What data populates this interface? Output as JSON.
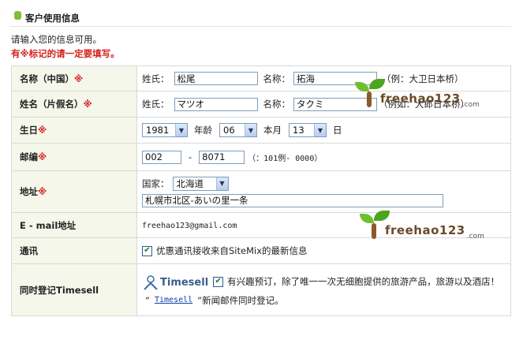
{
  "header": {
    "title": "客户使用信息"
  },
  "intro": "请输入您的信息可用。",
  "required_note": "有※标记的请一定要填写。",
  "required_mark": "※",
  "fields": {
    "name_kanji": {
      "label": "名称（中国）",
      "surname_label": "姓氏：",
      "surname_value": "松尾",
      "given_label": "名称：",
      "given_value": "拓海",
      "hint": "（例：大卫日本桥）"
    },
    "name_kana": {
      "label": "姓名（片假名）",
      "surname_label": "姓氏：",
      "surname_value": "マツオ",
      "given_label": "名称：",
      "given_value": "タクミ",
      "hint": "（例如：大郎日本桥）"
    },
    "birthday": {
      "label": "生日",
      "year": "1981",
      "year_label": "年龄",
      "month": "06",
      "month_label": "本月",
      "day": "13",
      "day_label": "日"
    },
    "postal": {
      "label": "邮编",
      "part1": "002",
      "separator": "-",
      "part2": "8071",
      "hint": "（：101例- 0000）"
    },
    "address": {
      "label": "地址",
      "prefecture_label": "国家：",
      "prefecture": "北海道",
      "street": "札幌市北区-あいの里一条"
    },
    "email": {
      "label": "E - mail地址",
      "value": "freehao123@gmail.com"
    },
    "newsletter": {
      "label": "通讯",
      "checked": true,
      "text": "优惠通讯接收来自SiteMix的最新信息"
    },
    "timesell": {
      "label": "同时登记Timesell",
      "logo_text": "Timesell",
      "checked": true,
      "text": "有兴趣预订，除了唯一一次无细胞提供的旅游产品，旅游以及酒店！",
      "note_open": "“",
      "link": "Timesell",
      "note_rest": "“新闻邮件同时登记。"
    }
  },
  "watermarks": [
    {
      "name": "freehao123",
      "domain": ".com"
    },
    {
      "name": "freehao123",
      "domain": ".com"
    }
  ],
  "colors": {
    "accent_green": "#7fbf3a",
    "required_red": "#d2231e",
    "label_bg": "#f5f7ea",
    "link_blue": "#0b3fa8"
  }
}
